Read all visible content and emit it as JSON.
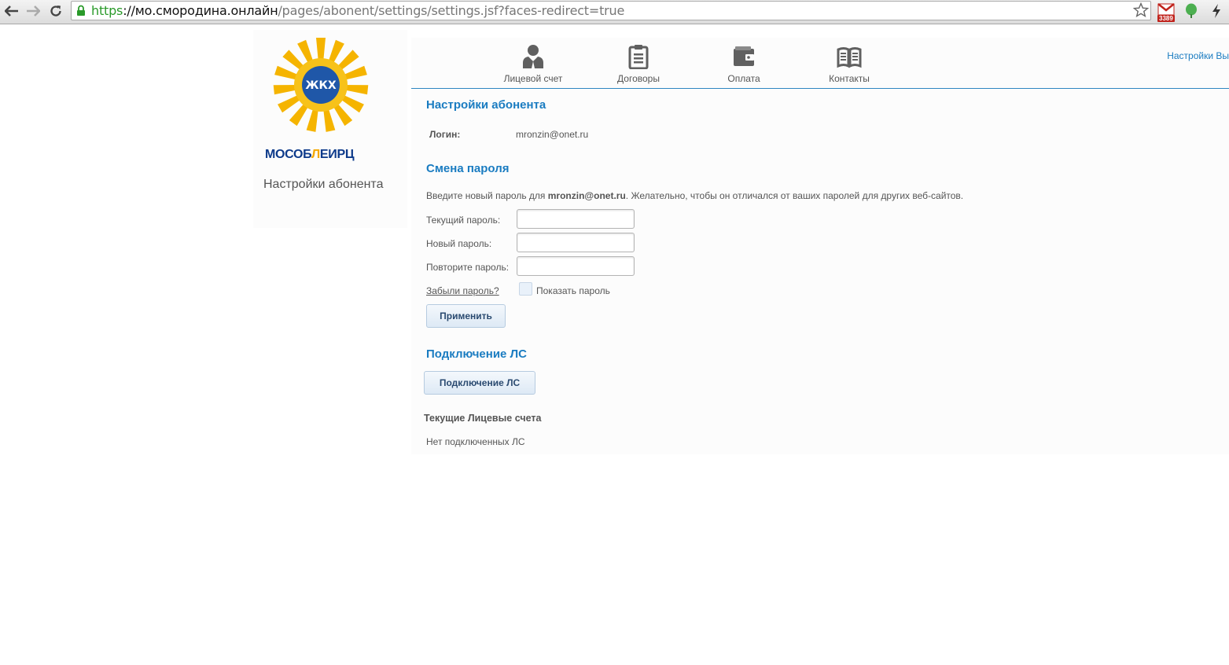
{
  "browser": {
    "url_scheme": "https",
    "url_host": "://мо.смородина.онлайн",
    "url_path": "/pages/abonent/settings/settings.jsf?faces-redirect=true",
    "gmail_count": "3389"
  },
  "colors": {
    "accent": "#1a7cc1",
    "logo_blue": "#0d3a8a",
    "logo_yellow": "#f5a800"
  },
  "sidebar": {
    "logo_part1": "МОСОБ",
    "logo_part2": "Л",
    "logo_part3": "ЕИРЦ",
    "logo_emblem_text": "ЖКХ",
    "title": "Настройки абонента"
  },
  "topnav": {
    "items": [
      {
        "label": "Лицевой счет",
        "icon": "person-icon"
      },
      {
        "label": "Договоры",
        "icon": "clipboard-icon"
      },
      {
        "label": "Оплата",
        "icon": "wallet-icon"
      },
      {
        "label": "Контакты",
        "icon": "book-icon"
      }
    ],
    "settings_link": "Настройки Вы"
  },
  "main": {
    "section_title": "Настройки абонента",
    "login_label": "Логин:",
    "login_value": "mronzin@onet.ru",
    "password_title": "Смена пароля",
    "password_hint_pre": "Введите новый пароль для ",
    "password_hint_user": "mronzin@onet.ru",
    "password_hint_post": ". Желательно, чтобы он отличался от ваших паролей для других веб-сайтов.",
    "current_password_label": "Текущий пароль:",
    "new_password_label": "Новый пароль:",
    "repeat_password_label": "Повторите пароль:",
    "forgot_password": "Забыли пароль?",
    "show_password": "Показать пароль",
    "apply_button": "Применить",
    "connect_title": "Подключение ЛС",
    "connect_button": "Подключение ЛС",
    "current_accounts_title": "Текущие Лицевые счета",
    "no_accounts": "Нет подключенных ЛС"
  }
}
